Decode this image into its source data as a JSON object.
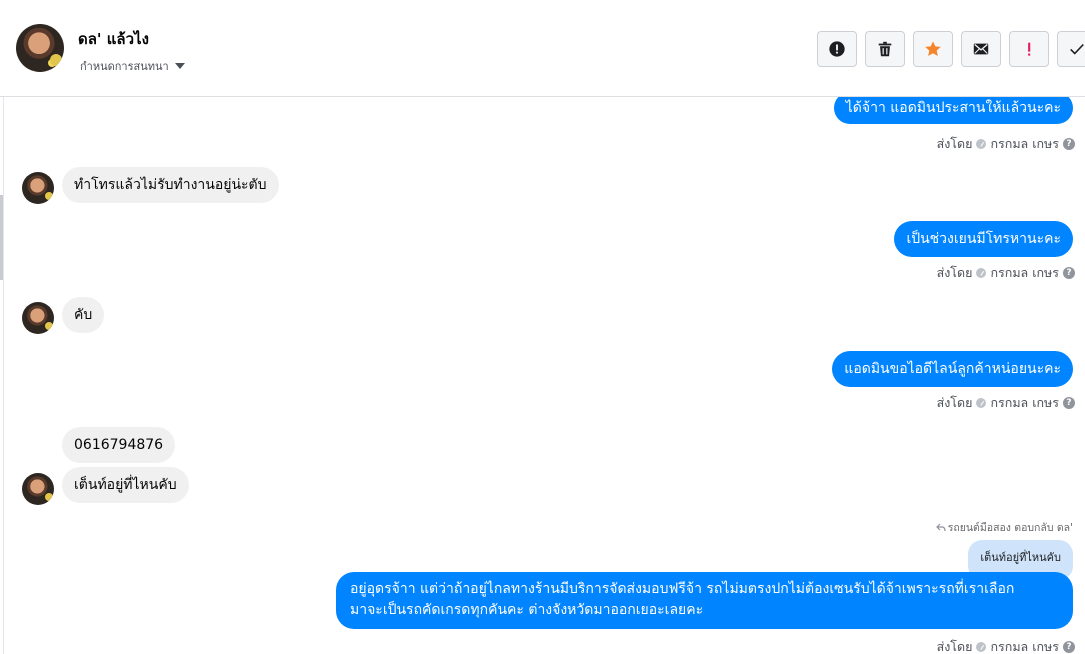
{
  "header": {
    "contact_name": "ดล' แล้วไง",
    "conversation_menu": "กำหนดการสนทนา",
    "tools": [
      {
        "name": "spam-icon"
      },
      {
        "name": "trash-icon"
      },
      {
        "name": "star-icon",
        "color": "#f5852a"
      },
      {
        "name": "mail-icon"
      },
      {
        "name": "important-icon",
        "color": "#e0245e"
      },
      {
        "name": "check-icon"
      }
    ]
  },
  "thread": {
    "sent_by_prefix": "ส่งโดย",
    "sent_by_name": "กรกมล เกษร",
    "messages": {
      "m1": "ได้จ้าา แอดมินประสานให้แล้วนะคะ",
      "m2": "ทำโทรแล้วไม่รับทำงานอยู่น่ะตับ",
      "m3": "เป็นช่วงเยนมีโทรหานะคะ",
      "m4": "คับ",
      "m5": "แอดมินขอไอดีไลน์ลูกค้าหน่อยนะคะ",
      "m6": "0616794876",
      "m7": "เต็นท์อยู่ที่ไหนคับ",
      "reply_label": "รถยนต์มือสอง ตอบกลับ ดล'",
      "reply_quote": "เต็นท์อยู่ที่ไหนคับ",
      "m8_line1": "อยู่อุดรจ้าา แต่ว่าถ้าอยู่ไกลทางร้านมีบริการจัดส่งมอบฟรีจ้า รถไม่มตรงปกไม่ต้องเซนรับได้จ้าเพราะรถที่เราเลือก",
      "m8_line2": "มาจะเป็นรถคัดเกรดทุกคันคะ ต่างจังหวัดมาออกเยอะเลยคะ"
    }
  }
}
